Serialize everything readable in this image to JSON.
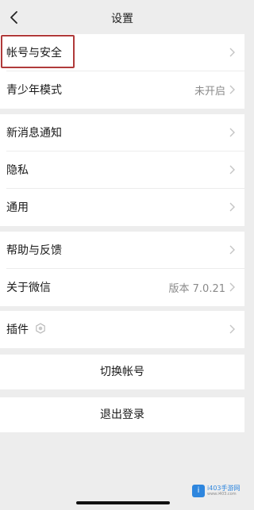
{
  "nav": {
    "title": "设置"
  },
  "sections": {
    "account": {
      "items": [
        {
          "label": "帐号与安全",
          "value": ""
        },
        {
          "label": "青少年模式",
          "value": "未开启"
        }
      ]
    },
    "general": {
      "items": [
        {
          "label": "新消息通知",
          "value": ""
        },
        {
          "label": "隐私",
          "value": ""
        },
        {
          "label": "通用",
          "value": ""
        }
      ]
    },
    "about": {
      "items": [
        {
          "label": "帮助与反馈",
          "value": ""
        },
        {
          "label": "关于微信",
          "value": "版本 7.0.21"
        }
      ]
    },
    "plugins": {
      "items": [
        {
          "label": "插件",
          "value": ""
        }
      ]
    }
  },
  "actions": {
    "switch_account": "切换帐号",
    "logout": "退出登录"
  },
  "watermark": {
    "brand": "i403手游网",
    "logo_glyph": "i",
    "sub": "www.i403.com"
  },
  "colors": {
    "background": "#ededed",
    "highlight_border": "#b03a3a",
    "secondary_text": "#8a8a8a"
  }
}
